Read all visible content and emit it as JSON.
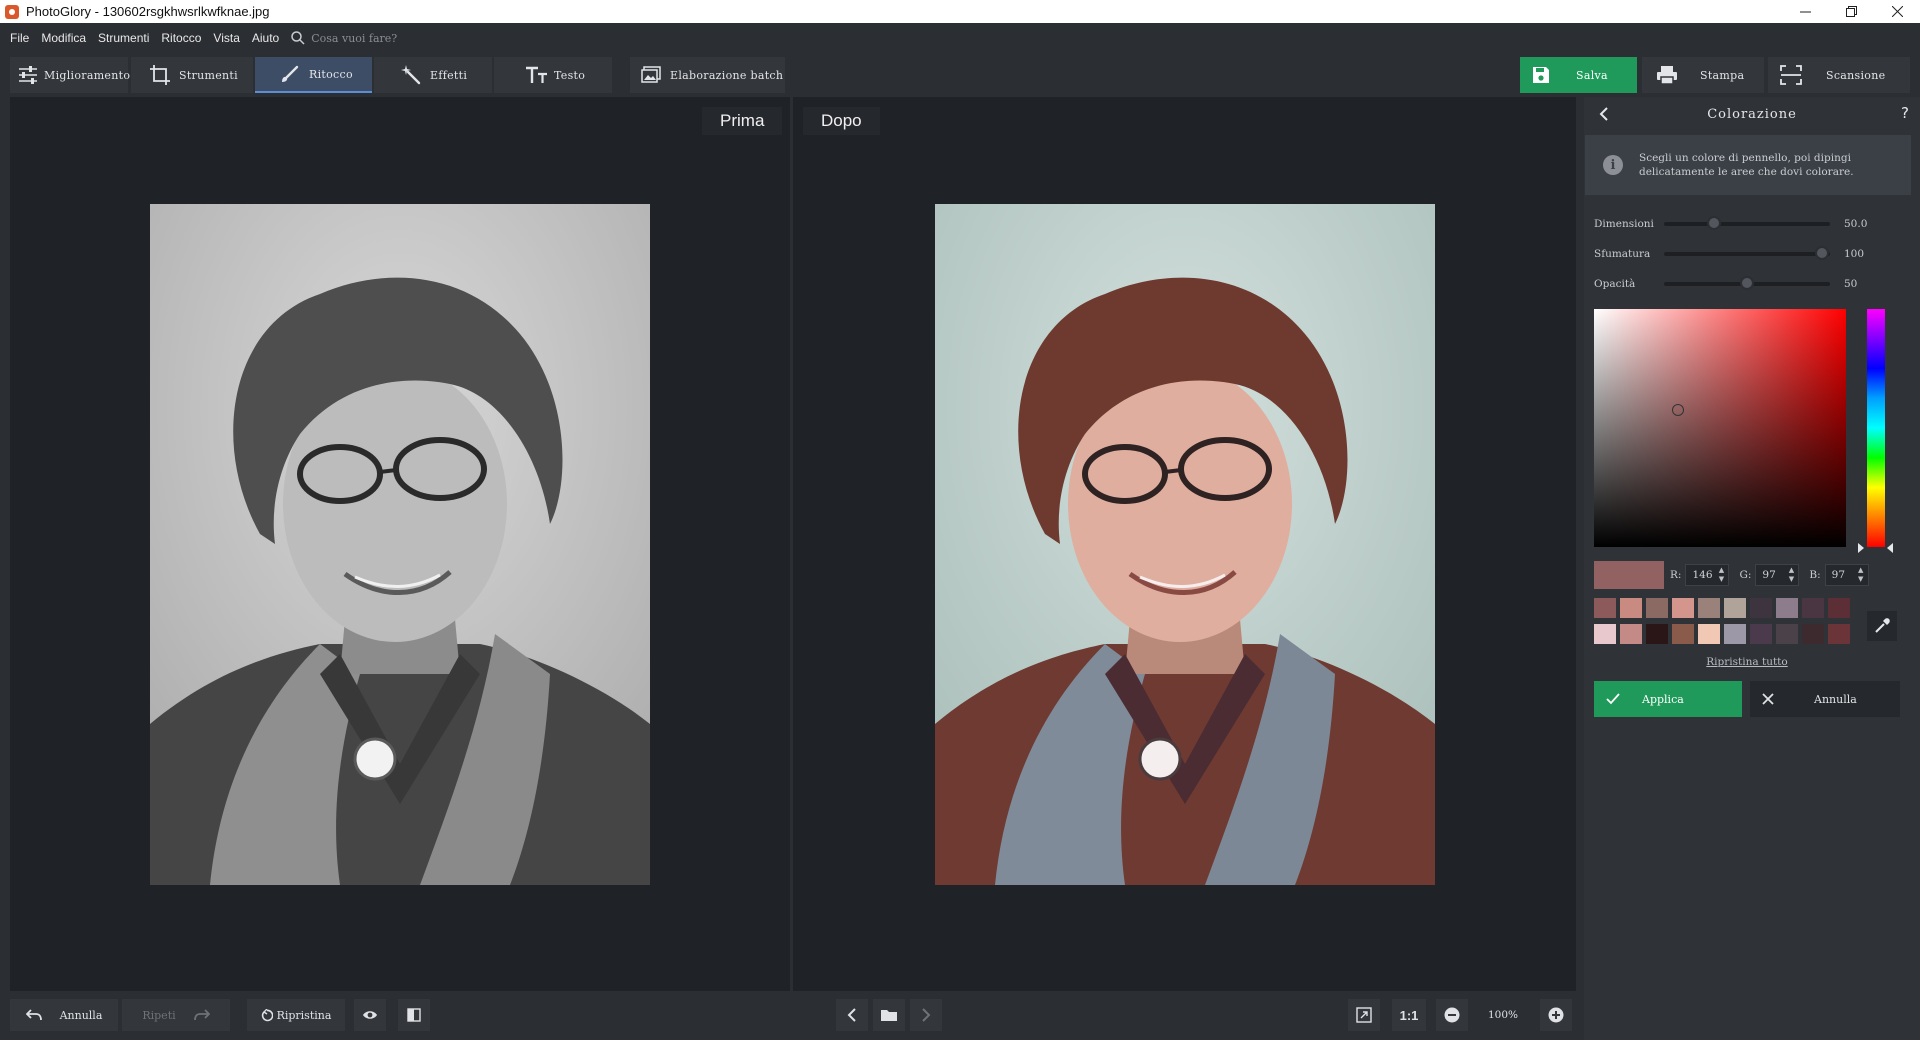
{
  "window": {
    "title": "PhotoGlory - 130602rsgkhwsrlkwfknae.jpg"
  },
  "menu": {
    "items": [
      "File",
      "Modifica",
      "Strumenti",
      "Ritocco",
      "Vista",
      "Aiuto"
    ],
    "search_placeholder": "Cosa vuoi fare?"
  },
  "toolbar": {
    "tabs": [
      {
        "label": "Miglioramento",
        "icon": "sliders-icon"
      },
      {
        "label": "Strumenti",
        "icon": "crop-icon"
      },
      {
        "label": "Ritocco",
        "icon": "brush-icon",
        "active": true
      },
      {
        "label": "Effetti",
        "icon": "magic-wand-icon"
      },
      {
        "label": "Testo",
        "icon": "text-icon"
      }
    ],
    "batch_label": "Elaborazione batch",
    "save_label": "Salva",
    "print_label": "Stampa",
    "scan_label": "Scansione"
  },
  "canvas": {
    "before_label": "Prima",
    "after_label": "Dopo"
  },
  "panel": {
    "title": "Colorazione",
    "help": "?",
    "info_text": "Scegli un colore di pennello, poi dipingi delicatamente le aree che dovi colorare.",
    "sliders": [
      {
        "label": "Dimensioni",
        "value": "50.0",
        "level": 0.3
      },
      {
        "label": "Sfumatura",
        "value": "100",
        "level": 0.95
      },
      {
        "label": "Opacità",
        "value": "50",
        "level": 0.5
      }
    ],
    "rgb": {
      "r_label": "R:",
      "r": "146",
      "g_label": "G:",
      "g": "97",
      "b_label": "B:",
      "b": "97"
    },
    "current_color": "#926161",
    "swatches_row1": [
      "#8c5a5a",
      "#c98a82",
      "#8a6a62",
      "#d4968c",
      "#9a827a",
      "#b0a49a",
      "#3e3440",
      "#8c7c8c",
      "#4a3642",
      "#5c2e36"
    ],
    "swatches_row2": [
      "#e8c8cc",
      "#c48a86",
      "#2a1616",
      "#8a5a4a",
      "#f0c8b4",
      "#9c98a8",
      "#4a3a4c",
      "#4a4248",
      "#3c2a2e",
      "#6a3438"
    ],
    "reset_all": "Ripristina tutto",
    "apply_label": "Applica",
    "cancel_label": "Annulla"
  },
  "bottom": {
    "undo_label": "Annulla",
    "redo_label": "Ripeti",
    "reset_label": "Ripristina",
    "ratio_label": "1:1",
    "zoom": "100%"
  }
}
